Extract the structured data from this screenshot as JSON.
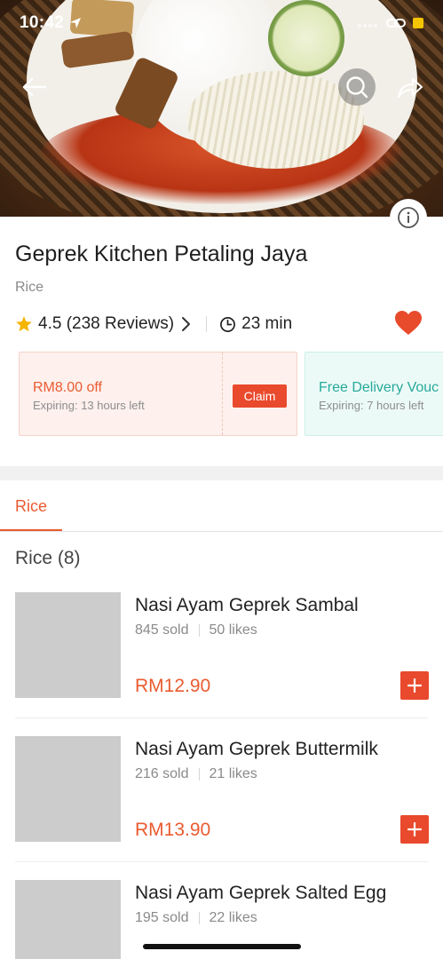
{
  "status_bar": {
    "time": "10:42"
  },
  "shop": {
    "name": "Geprek Kitchen Petaling Jaya",
    "category": "Rice",
    "rating_text": "4.5 (238 Reviews)",
    "delivery_time": "23 min",
    "favorited": true
  },
  "vouchers": [
    {
      "title": "RM8.00 off",
      "subtitle": "Expiring: 13 hours left",
      "button": "Claim",
      "accent": "#ea5b30"
    },
    {
      "title": "Free Delivery Vouc",
      "subtitle": "Expiring: 7 hours left",
      "accent": "#26a99a"
    }
  ],
  "tabs": [
    {
      "label": "Rice",
      "active": true
    }
  ],
  "section": {
    "title": "Rice (8)"
  },
  "items": [
    {
      "name": "Nasi Ayam Geprek Sambal",
      "sold": "845 sold",
      "likes": "50 likes",
      "price": "RM12.90"
    },
    {
      "name": "Nasi Ayam Geprek Buttermilk",
      "sold": "216 sold",
      "likes": "21 likes",
      "price": "RM13.90"
    },
    {
      "name": "Nasi Ayam Geprek Salted Egg",
      "sold": "195 sold",
      "likes": "22 likes",
      "price": ""
    }
  ],
  "colors": {
    "accent": "#ea5b30",
    "button": "#e9492c",
    "teal": "#26a99a",
    "heart": "#e84a2c"
  },
  "icons": [
    "back-arrow-icon",
    "search-icon",
    "share-icon",
    "info-icon",
    "star-icon",
    "chevron-right-icon",
    "clock-icon",
    "heart-icon",
    "plus-icon"
  ]
}
